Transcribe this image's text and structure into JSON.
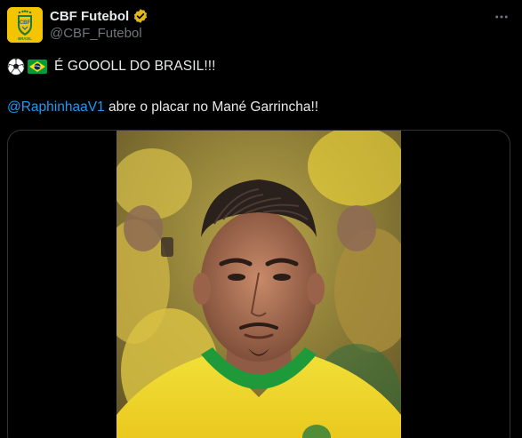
{
  "account": {
    "display_name": "CBF Futebol",
    "handle": "@CBF_Futebol",
    "verified": true,
    "verified_color": "#e2b719",
    "avatar_background": "#f5c400",
    "avatar_icon": "cbf-crest-icon"
  },
  "post": {
    "headline": "É GOOOLL DO BRASIL!!!",
    "emojis": [
      "soccer-ball-icon",
      "brazil-flag-icon"
    ],
    "mention": "@RaphinhaaV1",
    "body": " abre o placar no Mané Garrincha!!",
    "media": {
      "type": "video",
      "description_icon": "player-closeup-image"
    }
  },
  "colors": {
    "background": "#000000",
    "text": "#e7e9ea",
    "secondary_text": "#71767b",
    "link": "#1d9bf0",
    "border": "#2f3336"
  }
}
